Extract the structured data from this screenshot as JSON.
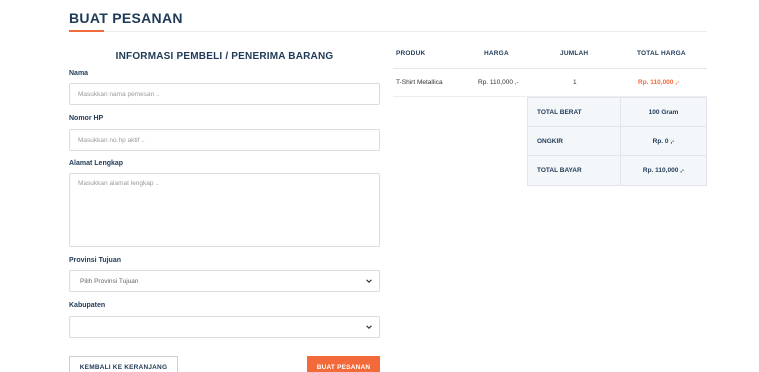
{
  "page": {
    "title": "BUAT PESANAN"
  },
  "form": {
    "heading": "INFORMASI PEMBELI / PENERIMA BARANG",
    "name": {
      "label": "Nama",
      "placeholder": "Masukkan nama pemesan ..",
      "value": ""
    },
    "phone": {
      "label": "Nomor HP",
      "placeholder": "Masukkan no.hp aktif ..",
      "value": ""
    },
    "address": {
      "label": "Alamat Lengkap",
      "placeholder": "Masukkan alamat lengkap ..",
      "value": ""
    },
    "province": {
      "label": "Provinsi Tujuan",
      "selected": "Pilih Provinsi Tujuan"
    },
    "regency": {
      "label": "Kabupaten",
      "selected": ""
    },
    "back_button": "KEMBALI KE KERANJANG",
    "submit_button": "BUAT PESANAN"
  },
  "order_table": {
    "headers": [
      "PRODUK",
      "HARGA",
      "JUMLAH",
      "TOTAL HARGA"
    ],
    "rows": [
      {
        "product": "T-Shirt Metallica",
        "price": "Rp. 110,000 ,-",
        "qty": "1",
        "total": "Rp. 110,000 ,-"
      }
    ]
  },
  "summary": {
    "weight_label": "TOTAL BERAT",
    "weight_value": "100 Gram",
    "shipping_label": "ONGKIR",
    "shipping_value": "Rp. 0 ,-",
    "pay_label": "TOTAL BAYAR",
    "pay_value": "Rp. 110,000 ,-"
  },
  "colors": {
    "accent": "#f26a3a",
    "navy": "#1f3a57"
  },
  "icons": {
    "select_arrow": "chevron-down-icon"
  }
}
